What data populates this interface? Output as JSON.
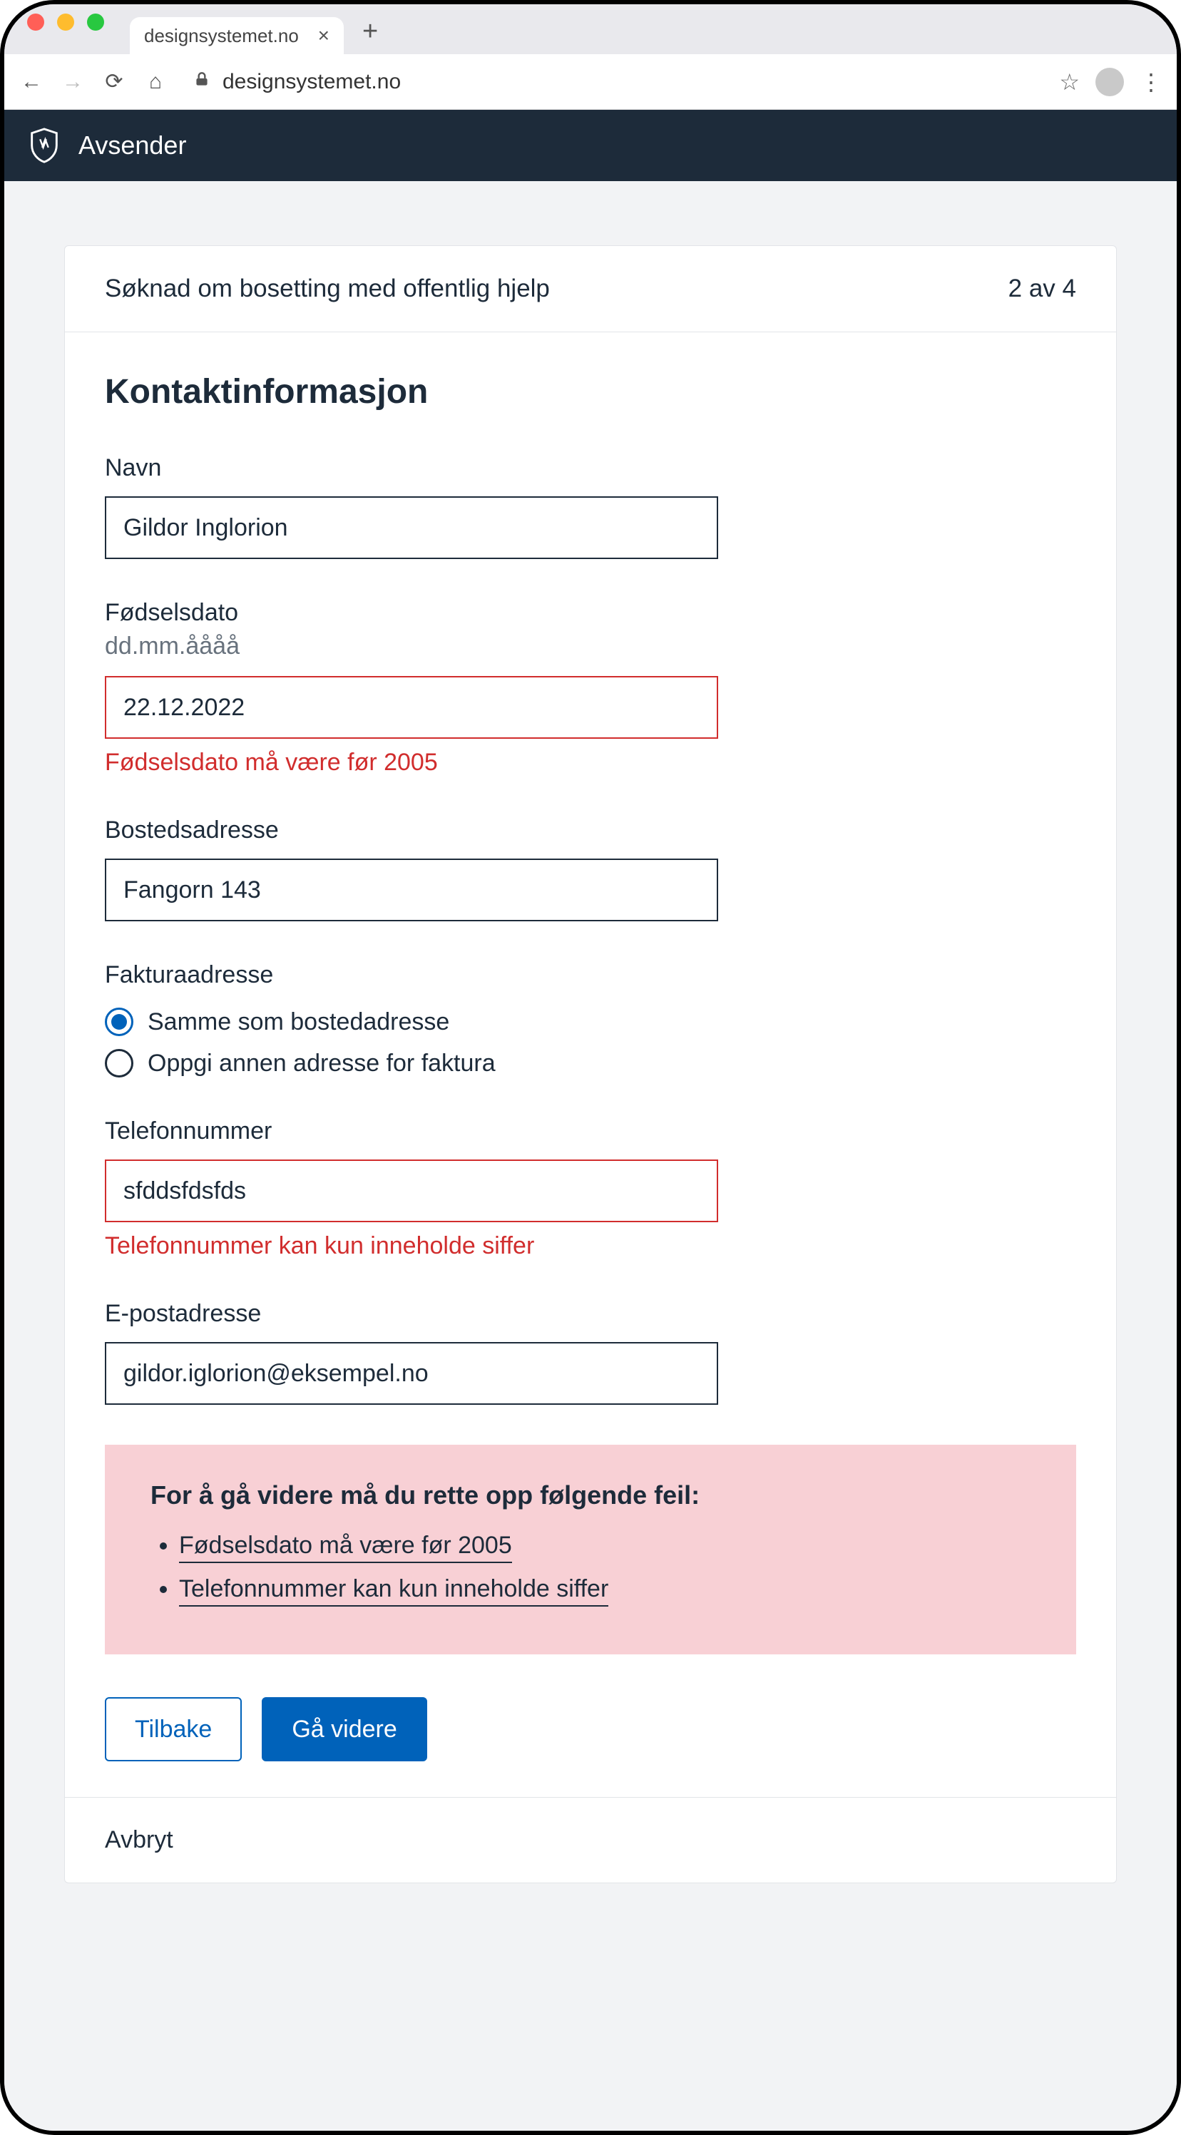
{
  "browser": {
    "tab_title": "designsystemet.no",
    "url": "designsystemet.no"
  },
  "app_header": {
    "title": "Avsender"
  },
  "card_header": {
    "title": "Søknad om bosetting med offentlig hjelp",
    "step": "2 av 4"
  },
  "form": {
    "heading": "Kontaktinformasjon",
    "name": {
      "label": "Navn",
      "value": "Gildor Inglorion"
    },
    "birthdate": {
      "label": "Fødselsdato",
      "hint": "dd.mm.åååå",
      "value": "22.12.2022",
      "error": "Fødselsdato må være før 2005"
    },
    "address": {
      "label": "Bostedsadresse",
      "value": "Fangorn 143"
    },
    "invoice_address": {
      "legend": "Fakturaadresse",
      "options": [
        {
          "label": "Samme som bostedadresse",
          "selected": true
        },
        {
          "label": "Oppgi annen adresse for faktura",
          "selected": false
        }
      ]
    },
    "phone": {
      "label": "Telefonnummer",
      "value": "sfddsfdsfds",
      "error": "Telefonnummer kan kun inneholde siffer"
    },
    "email": {
      "label": "E-postadresse",
      "value": "gildor.iglorion@eksempel.no"
    }
  },
  "error_summary": {
    "heading": "For å gå videre må du rette opp følgende feil:",
    "items": [
      "Fødselsdato må være før 2005",
      "Telefonnummer kan kun inneholde siffer"
    ]
  },
  "actions": {
    "back": "Tilbake",
    "next": "Gå videre",
    "cancel": "Avbryt"
  }
}
